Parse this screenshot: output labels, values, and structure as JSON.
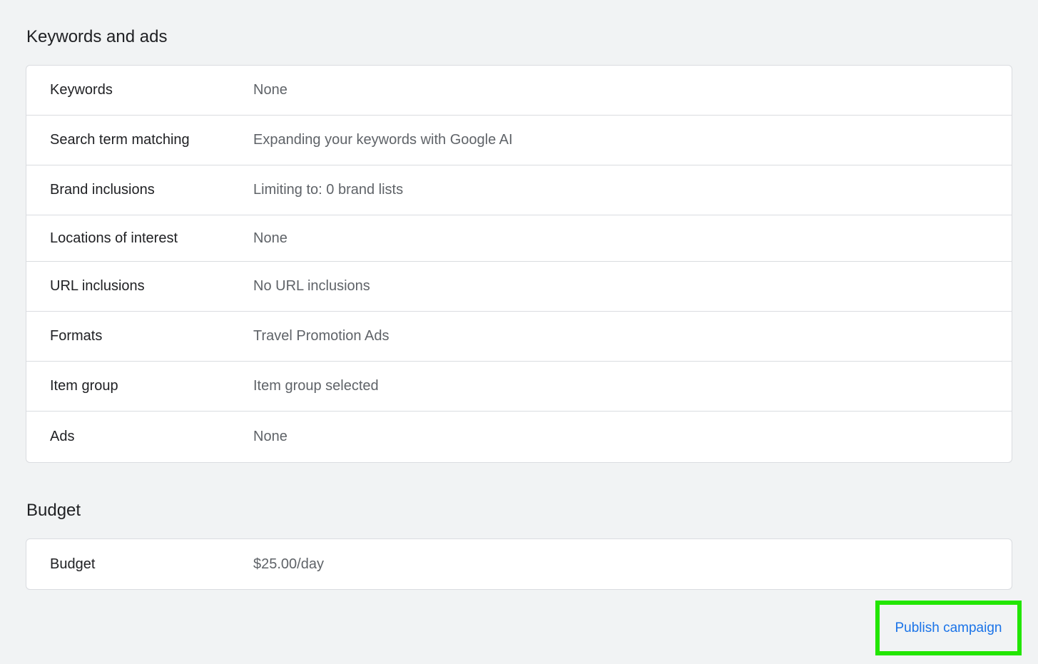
{
  "keywords_section": {
    "title": "Keywords and ads",
    "rows": [
      {
        "label": "Keywords",
        "value": "None"
      },
      {
        "label": "Search term matching",
        "value": "Expanding your keywords with Google AI"
      },
      {
        "label": "Brand inclusions",
        "value": "Limiting to: 0 brand lists"
      },
      {
        "label": "Locations of interest",
        "value": "None"
      },
      {
        "label": "URL inclusions",
        "value": "No URL inclusions"
      },
      {
        "label": "Formats",
        "value": "Travel Promotion Ads"
      },
      {
        "label": "Item group",
        "value": "Item group selected"
      },
      {
        "label": "Ads",
        "value": "None"
      }
    ]
  },
  "budget_section": {
    "title": "Budget",
    "rows": [
      {
        "label": "Budget",
        "value": "$25.00/day"
      }
    ]
  },
  "actions": {
    "publish_label": "Publish campaign"
  },
  "colors": {
    "background": "#f1f3f4",
    "card": "#ffffff",
    "border": "#dadce0",
    "label_text": "#202124",
    "value_text": "#5f6368",
    "link_blue": "#1a73e8",
    "highlight_green": "#22e600"
  }
}
